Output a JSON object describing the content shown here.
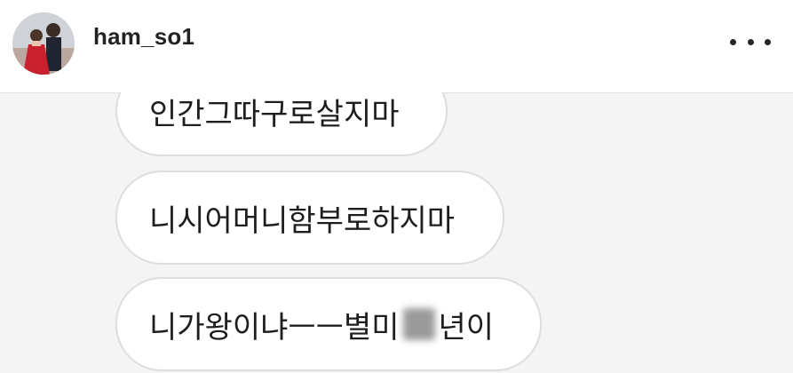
{
  "header": {
    "username": "ham_so1",
    "avatar_icon": "profile-photo-avatar",
    "more_icon": "more-horizontal-icon"
  },
  "messages": [
    {
      "text": "인간그따구로살지마"
    },
    {
      "text": "니시어머니함부로하지마"
    },
    {
      "text_before": "니가왕이냐ㅡㅡ별미",
      "text_after": "년이",
      "redaction": "blurred-character"
    }
  ],
  "colors": {
    "background": "#f4f4f4",
    "header": "#ffffff",
    "bubble_border": "#dddddd",
    "text": "#1e1e1e"
  }
}
